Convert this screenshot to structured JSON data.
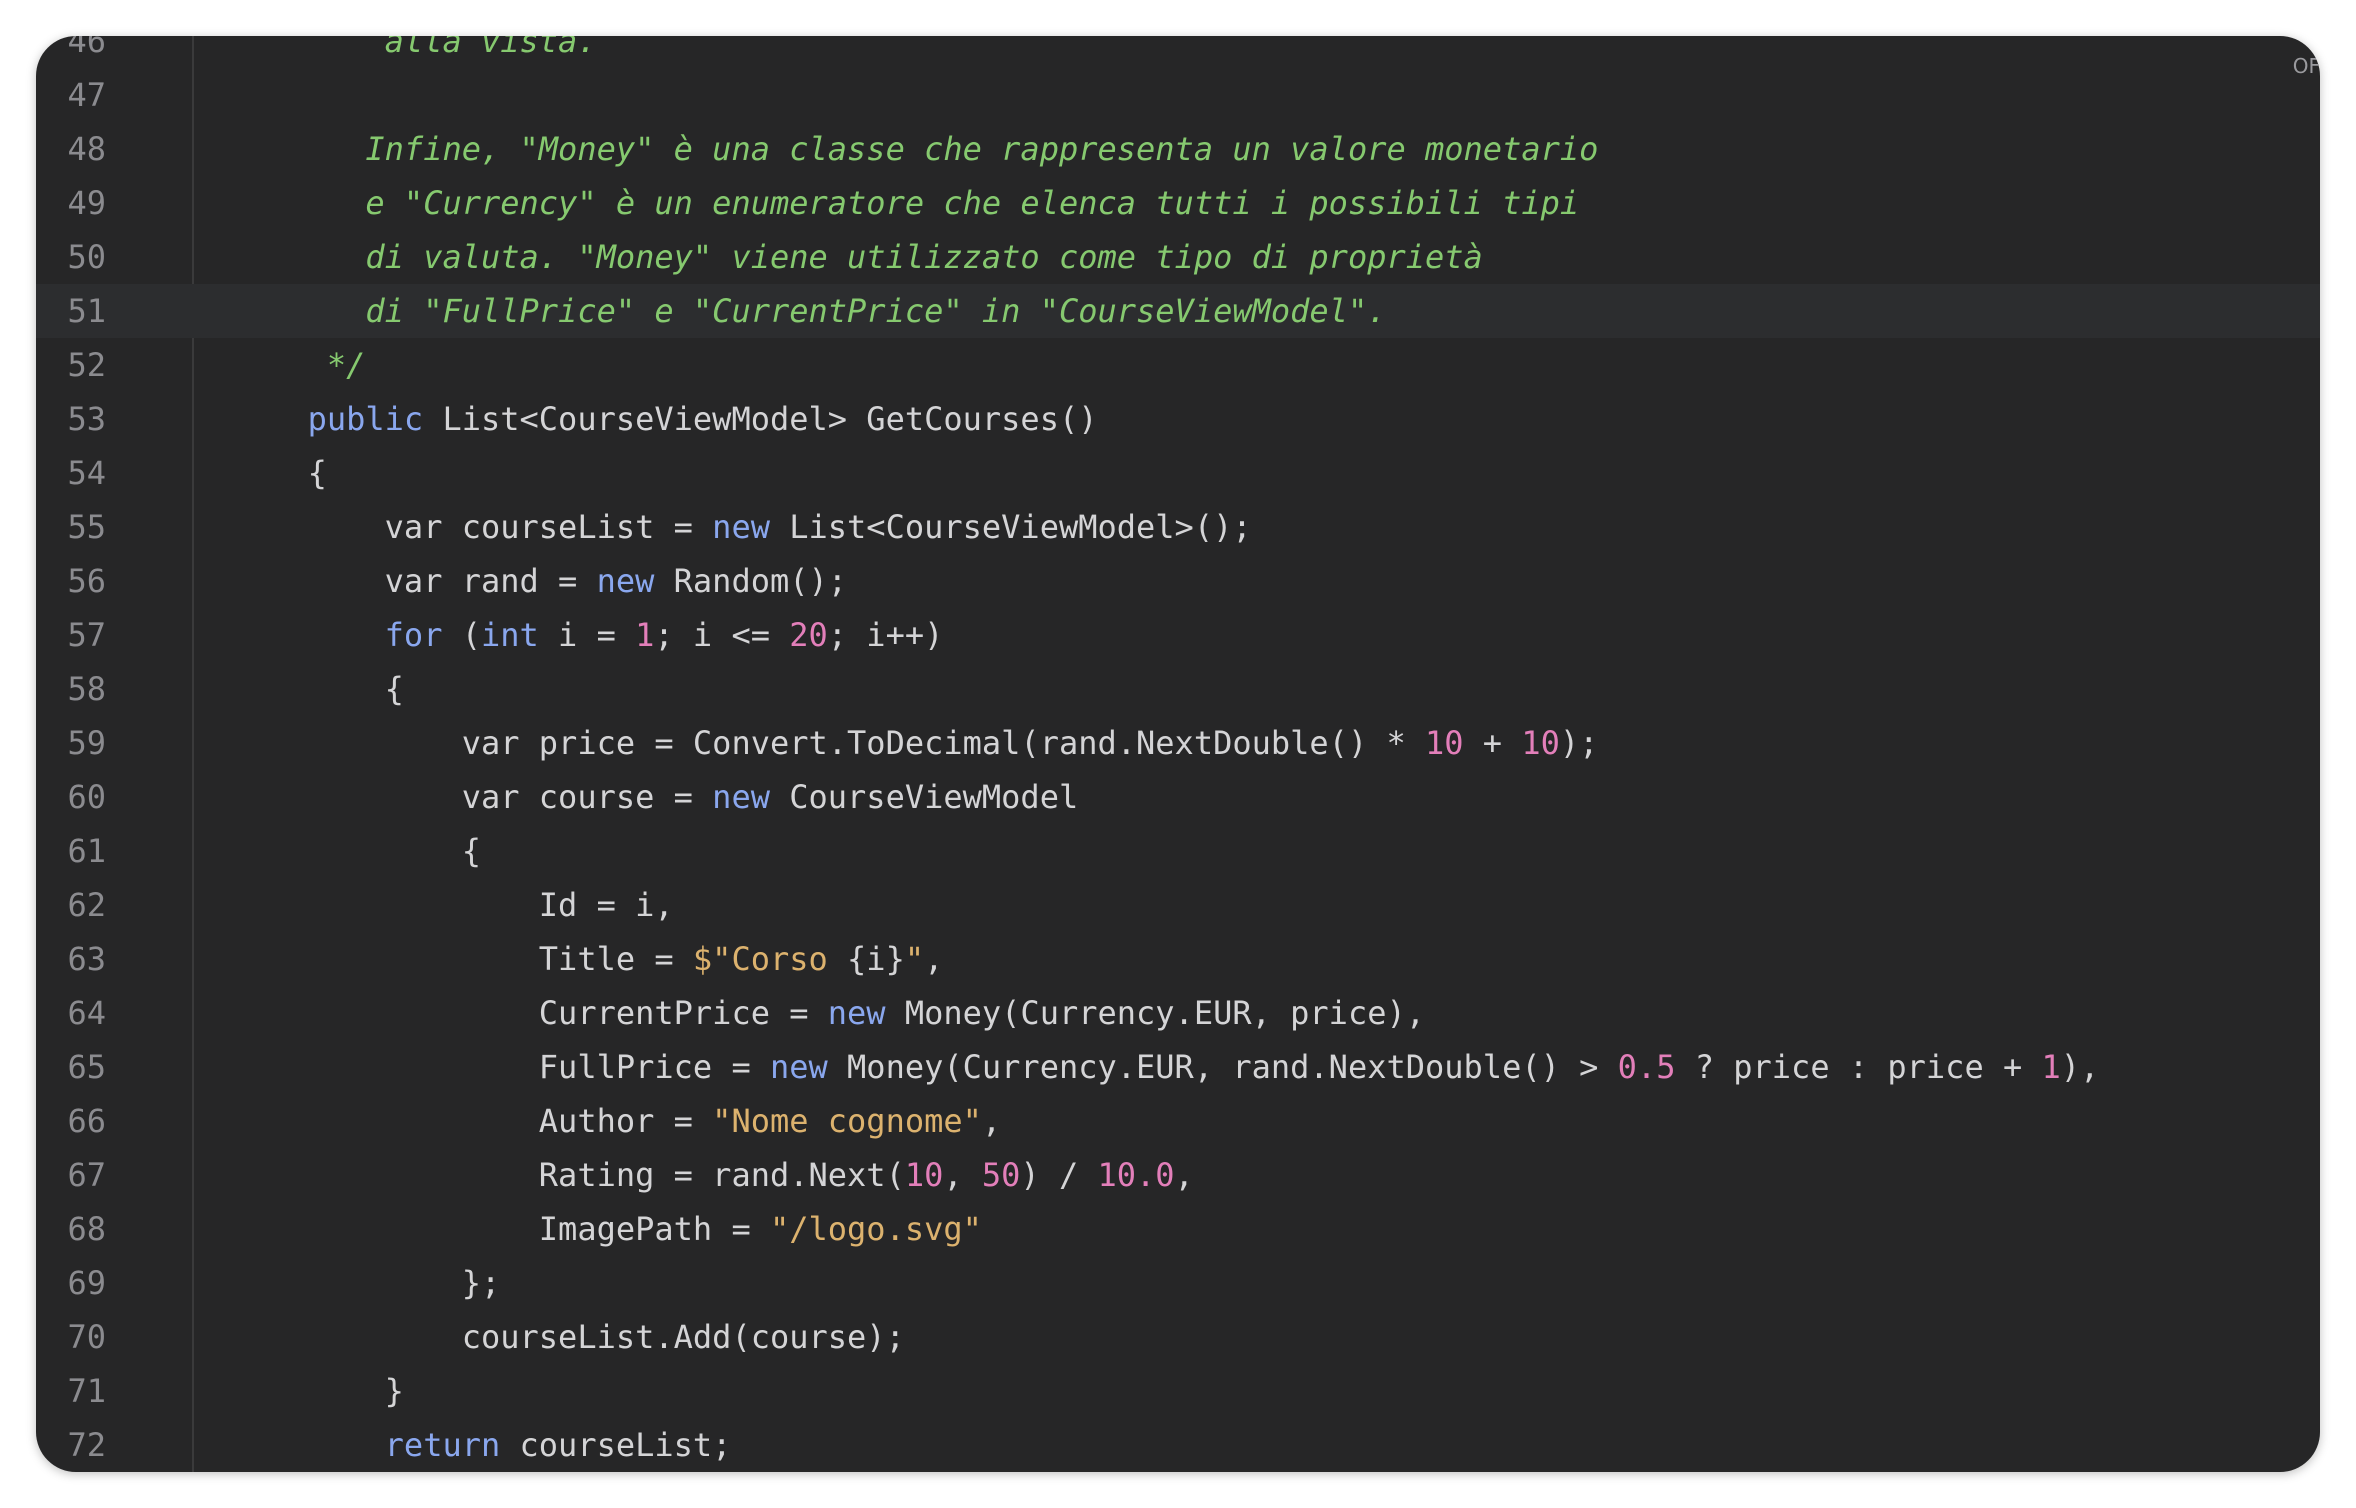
{
  "editor": {
    "corner_label": "OF",
    "current_line": 51,
    "lines": [
      {
        "n": "46",
        "tokens": [
          {
            "t": "          alla vista.",
            "c": "cmt"
          }
        ]
      },
      {
        "n": "47",
        "tokens": []
      },
      {
        "n": "48",
        "tokens": [
          {
            "t": "         Infine, \"Money\" è una classe che rappresenta un valore monetario",
            "c": "cmt"
          }
        ]
      },
      {
        "n": "49",
        "tokens": [
          {
            "t": "         e \"Currency\" è un enumeratore che elenca tutti i possibili tipi",
            "c": "cmt"
          }
        ]
      },
      {
        "n": "50",
        "tokens": [
          {
            "t": "         di valuta. \"Money\" viene utilizzato come tipo di proprietà",
            "c": "cmt"
          }
        ]
      },
      {
        "n": "51",
        "tokens": [
          {
            "t": "         di \"FullPrice\" e \"CurrentPrice\" in \"CourseViewModel\".",
            "c": "cmt"
          }
        ]
      },
      {
        "n": "52",
        "tokens": [
          {
            "t": "       */",
            "c": "cmt"
          }
        ]
      },
      {
        "n": "53",
        "tokens": [
          {
            "t": "      ",
            "c": "id"
          },
          {
            "t": "public",
            "c": "kw"
          },
          {
            "t": " List<CourseViewModel> GetCourses()",
            "c": "id"
          }
        ]
      },
      {
        "n": "54",
        "tokens": [
          {
            "t": "      {",
            "c": "id"
          }
        ]
      },
      {
        "n": "55",
        "tokens": [
          {
            "t": "          var courseList = ",
            "c": "id"
          },
          {
            "t": "new",
            "c": "kw"
          },
          {
            "t": " List<CourseViewModel>();",
            "c": "id"
          }
        ]
      },
      {
        "n": "56",
        "tokens": [
          {
            "t": "          var rand = ",
            "c": "id"
          },
          {
            "t": "new",
            "c": "kw"
          },
          {
            "t": " Random();",
            "c": "id"
          }
        ]
      },
      {
        "n": "57",
        "tokens": [
          {
            "t": "          ",
            "c": "id"
          },
          {
            "t": "for",
            "c": "kw"
          },
          {
            "t": " (",
            "c": "id"
          },
          {
            "t": "int",
            "c": "kw"
          },
          {
            "t": " i = ",
            "c": "id"
          },
          {
            "t": "1",
            "c": "num"
          },
          {
            "t": "; i <= ",
            "c": "id"
          },
          {
            "t": "20",
            "c": "num"
          },
          {
            "t": "; i++)",
            "c": "id"
          }
        ]
      },
      {
        "n": "58",
        "tokens": [
          {
            "t": "          {",
            "c": "id"
          }
        ]
      },
      {
        "n": "59",
        "tokens": [
          {
            "t": "              var price = Convert.ToDecimal(rand.NextDouble() * ",
            "c": "id"
          },
          {
            "t": "10",
            "c": "num"
          },
          {
            "t": " + ",
            "c": "id"
          },
          {
            "t": "10",
            "c": "num"
          },
          {
            "t": ");",
            "c": "id"
          }
        ]
      },
      {
        "n": "60",
        "tokens": [
          {
            "t": "              var course = ",
            "c": "id"
          },
          {
            "t": "new",
            "c": "kw"
          },
          {
            "t": " CourseViewModel",
            "c": "id"
          }
        ]
      },
      {
        "n": "61",
        "tokens": [
          {
            "t": "              {",
            "c": "id"
          }
        ]
      },
      {
        "n": "62",
        "tokens": [
          {
            "t": "                  Id = i,",
            "c": "id"
          }
        ]
      },
      {
        "n": "63",
        "tokens": [
          {
            "t": "                  Title = ",
            "c": "id"
          },
          {
            "t": "$\"Corso ",
            "c": "str"
          },
          {
            "t": "{i}",
            "c": "id"
          },
          {
            "t": "\"",
            "c": "str"
          },
          {
            "t": ",",
            "c": "id"
          }
        ]
      },
      {
        "n": "64",
        "tokens": [
          {
            "t": "                  CurrentPrice = ",
            "c": "id"
          },
          {
            "t": "new",
            "c": "kw"
          },
          {
            "t": " Money(Currency.EUR, price),",
            "c": "id"
          }
        ]
      },
      {
        "n": "65",
        "tokens": [
          {
            "t": "                  FullPrice = ",
            "c": "id"
          },
          {
            "t": "new",
            "c": "kw"
          },
          {
            "t": " Money(Currency.EUR, rand.NextDouble() > ",
            "c": "id"
          },
          {
            "t": "0.5",
            "c": "num"
          },
          {
            "t": " ? price : price + ",
            "c": "id"
          },
          {
            "t": "1",
            "c": "num"
          },
          {
            "t": "),",
            "c": "id"
          }
        ]
      },
      {
        "n": "66",
        "tokens": [
          {
            "t": "                  Author = ",
            "c": "id"
          },
          {
            "t": "\"Nome cognome\"",
            "c": "str"
          },
          {
            "t": ",",
            "c": "id"
          }
        ]
      },
      {
        "n": "67",
        "tokens": [
          {
            "t": "                  Rating = rand.Next(",
            "c": "id"
          },
          {
            "t": "10",
            "c": "num"
          },
          {
            "t": ", ",
            "c": "id"
          },
          {
            "t": "50",
            "c": "num"
          },
          {
            "t": ") / ",
            "c": "id"
          },
          {
            "t": "10.0",
            "c": "num"
          },
          {
            "t": ",",
            "c": "id"
          }
        ]
      },
      {
        "n": "68",
        "tokens": [
          {
            "t": "                  ImagePath = ",
            "c": "id"
          },
          {
            "t": "\"/logo.svg\"",
            "c": "str"
          }
        ]
      },
      {
        "n": "69",
        "tokens": [
          {
            "t": "              };",
            "c": "id"
          }
        ]
      },
      {
        "n": "70",
        "tokens": [
          {
            "t": "              courseList.Add(course);",
            "c": "id"
          }
        ]
      },
      {
        "n": "71",
        "tokens": [
          {
            "t": "          }",
            "c": "id"
          }
        ]
      },
      {
        "n": "72",
        "tokens": [
          {
            "t": "          ",
            "c": "id"
          },
          {
            "t": "return",
            "c": "kw"
          },
          {
            "t": " courseList;",
            "c": "id"
          }
        ]
      }
    ]
  }
}
